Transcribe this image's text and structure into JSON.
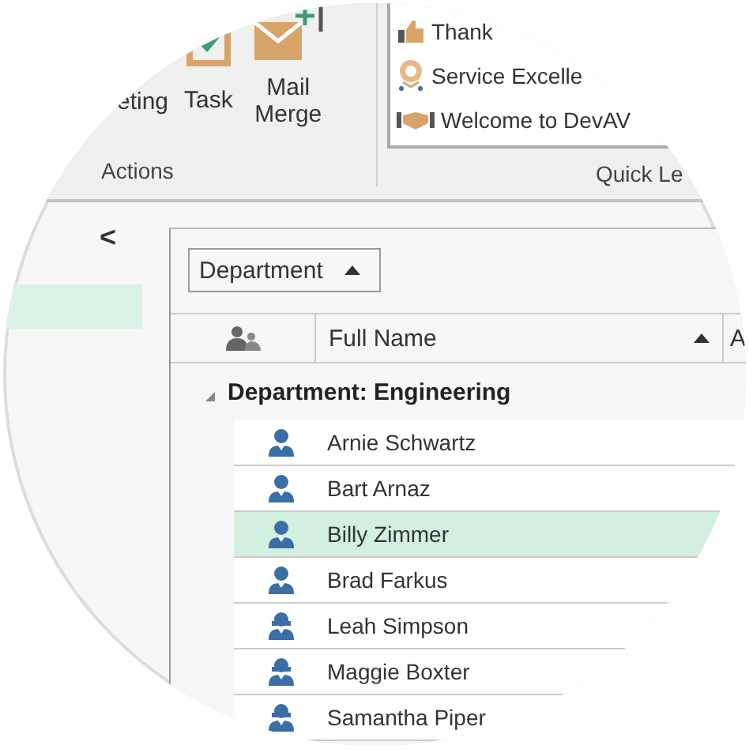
{
  "ribbon": {
    "actions": {
      "label": "Actions",
      "buttons": [
        {
          "kind": "meeting",
          "label": "eting"
        },
        {
          "kind": "task",
          "label": "Task"
        },
        {
          "kind": "mail-merge",
          "label": "Mail Merge"
        }
      ]
    },
    "quick_letters": {
      "label": "Quick Le",
      "items": [
        {
          "kind": "thanks",
          "label": "Thank"
        },
        {
          "kind": "award",
          "label": "Service Excelle"
        },
        {
          "kind": "welcome",
          "label": "Welcome to DevAV"
        }
      ]
    }
  },
  "nav": {
    "collapse_glyph": "<",
    "items": [
      {
        "selected": true
      }
    ]
  },
  "grid": {
    "group_panel": [
      {
        "label": "Department",
        "sorted": true
      }
    ],
    "columns": [
      {
        "kind": "icon"
      },
      {
        "kind": "text",
        "label": "Full Name",
        "sorted": true
      },
      {
        "kind": "text",
        "label": "A"
      }
    ],
    "groups": [
      {
        "label": "Department: Engineering",
        "expanded": true,
        "rows": [
          {
            "name": "Arnie Schwartz",
            "kind": "male",
            "selected": false
          },
          {
            "name": "Bart Arnaz",
            "kind": "male",
            "selected": false
          },
          {
            "name": "Billy Zimmer",
            "kind": "male",
            "selected": true
          },
          {
            "name": "Brad Farkus",
            "kind": "male",
            "selected": false
          },
          {
            "name": "Leah Simpson",
            "kind": "female",
            "selected": false
          },
          {
            "name": "Maggie Boxter",
            "kind": "female",
            "selected": false
          },
          {
            "name": "Samantha Piper",
            "kind": "female",
            "selected": false
          }
        ]
      }
    ]
  }
}
